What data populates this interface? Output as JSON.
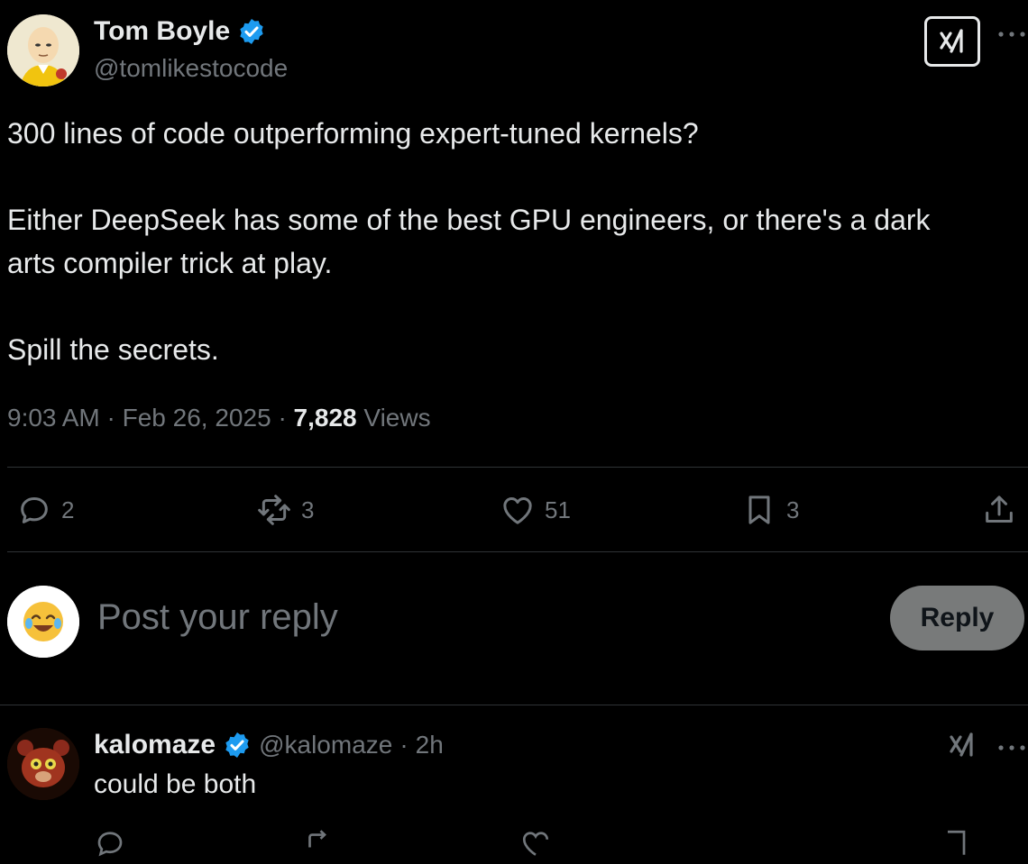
{
  "tweet": {
    "author_name": "Tom Boyle",
    "author_handle": "@tomlikestocode",
    "text_lines": [
      "300 lines of code outperforming expert-tuned kernels?",
      "Either DeepSeek has some of the best GPU engineers, or there's a dark",
      "arts compiler trick at play.",
      "Spill the secrets."
    ],
    "time": "9:03 AM",
    "date": "Feb 26, 2025",
    "views_count": "7,828",
    "views_label": "Views",
    "separator": "·"
  },
  "actions": {
    "replies": "2",
    "reposts": "3",
    "likes": "51",
    "bookmarks": "3"
  },
  "reply_box": {
    "placeholder": "Post your reply",
    "button_label": "Reply"
  },
  "reply": {
    "author_name": "kalomaze",
    "author_handle": "@kalomaze",
    "time_ago": "2h",
    "separator": "·",
    "text": "could be both"
  },
  "icons": {
    "verified": "verified-badge-icon",
    "grok": "grok-icon",
    "more": "more-dots-icon",
    "reply": "reply-icon",
    "repost": "repost-icon",
    "like": "heart-icon",
    "bookmark": "bookmark-icon",
    "share": "share-icon"
  },
  "colors": {
    "background": "#000000",
    "text": "#e7e9ea",
    "muted": "#71767b",
    "verified": "#1d9bf0",
    "divider": "#2f3336",
    "reply_button": "#787a7a"
  }
}
